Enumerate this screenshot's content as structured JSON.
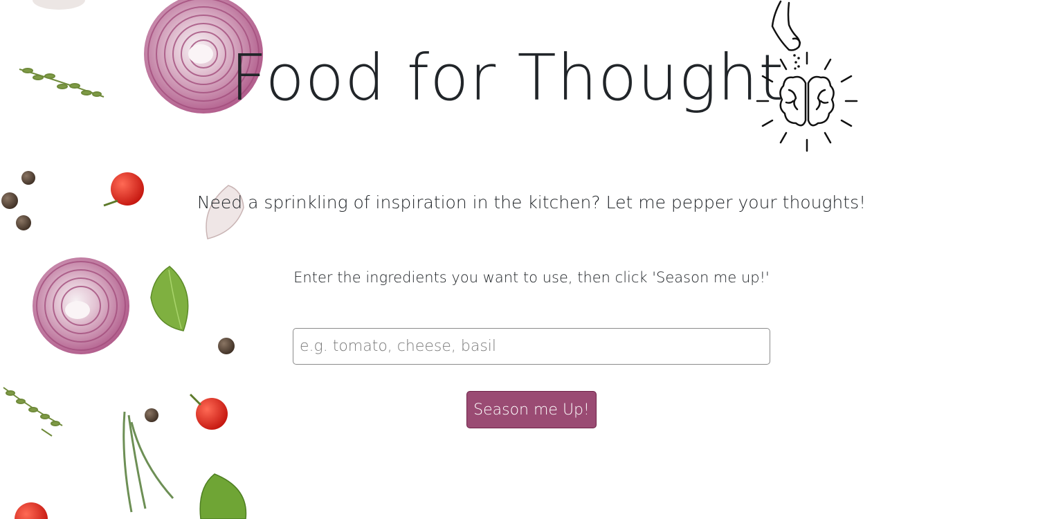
{
  "header": {
    "title": "Food for Thought",
    "logo_icon": "brain-salt-sprinkle-icon"
  },
  "main": {
    "tagline": "Need a sprinkling of inspiration in the kitchen? Let me pepper your thoughts!",
    "instructions": "Enter the ingredients you want to use, then click 'Season me up!'",
    "search": {
      "placeholder": "e.g. tomato, cheese, basil",
      "value": ""
    },
    "submit_label": "Season me Up!"
  },
  "background": {
    "decorations": [
      "onion-slice",
      "thyme-sprig",
      "garlic-clove",
      "peppercorn",
      "cherry-tomato",
      "basil-leaf",
      "rosemary-sprig"
    ]
  },
  "colors": {
    "button_bg": "#9a4b73",
    "button_border": "#6e2247",
    "text": "#212529"
  }
}
